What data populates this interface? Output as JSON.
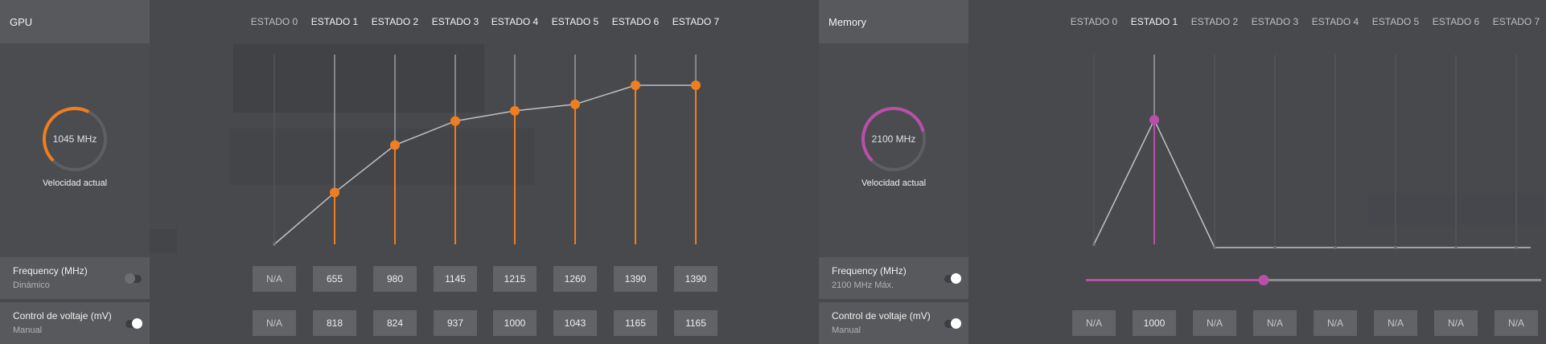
{
  "gpu": {
    "title": "GPU",
    "gauge": {
      "value_label": "1045 MHz",
      "caption": "Velocidad actual",
      "fraction": 0.6,
      "color": "#f07d1e"
    },
    "states": [
      "ESTADO 0",
      "ESTADO 1",
      "ESTADO 2",
      "ESTADO 3",
      "ESTADO 4",
      "ESTADO 5",
      "ESTADO 6",
      "ESTADO 7"
    ],
    "active_state_labels": [
      false,
      true,
      true,
      true,
      true,
      true,
      true,
      true
    ],
    "frequency": {
      "label": "Frequency (MHz)",
      "mode": "Dinámico",
      "toggle_on": false,
      "values": [
        "N/A",
        "655",
        "980",
        "1145",
        "1215",
        "1260",
        "1390",
        "1390"
      ]
    },
    "voltage": {
      "label": "Control de voltaje (mV)",
      "mode": "Manual",
      "toggle_on": true,
      "values": [
        "N/A",
        "818",
        "824",
        "937",
        "1000",
        "1043",
        "1165",
        "1165"
      ]
    },
    "curve": {
      "points": [
        null,
        655,
        980,
        1145,
        1215,
        1260,
        1390,
        1390
      ],
      "min": 300,
      "max": 1600,
      "accent": "#f07d1e"
    }
  },
  "memory": {
    "title": "Memory",
    "gauge": {
      "value_label": "2100 MHz",
      "caption": "Velocidad actual",
      "fraction": 0.78,
      "color": "#b94fa9"
    },
    "states": [
      "ESTADO 0",
      "ESTADO 1",
      "ESTADO 2",
      "ESTADO 3",
      "ESTADO 4",
      "ESTADO 5",
      "ESTADO 6",
      "ESTADO 7"
    ],
    "active_state_labels": [
      false,
      true,
      false,
      false,
      false,
      false,
      false,
      false
    ],
    "frequency": {
      "label": "Frequency (MHz)",
      "mode": "2100 MHz Máx.",
      "toggle_on": true,
      "slider_fraction": 0.39
    },
    "voltage": {
      "label": "Control de voltaje (mV)",
      "mode": "Manual",
      "toggle_on": true,
      "values": [
        "N/A",
        "1000",
        "N/A",
        "N/A",
        "N/A",
        "N/A",
        "N/A",
        "N/A"
      ]
    },
    "curve": {
      "points": [
        null,
        2100,
        null,
        null,
        null,
        null,
        null,
        null
      ],
      "min": 0,
      "max": 3200,
      "accent": "#b94fa9"
    }
  }
}
